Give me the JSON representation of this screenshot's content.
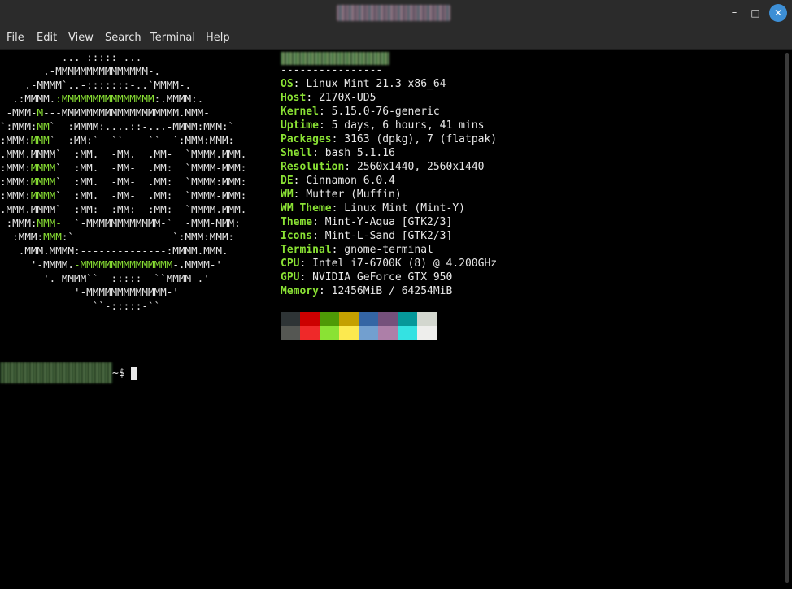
{
  "window": {
    "controls": {
      "minimize": "–",
      "maximize": "□",
      "close": "✕"
    }
  },
  "menu": [
    "File",
    "Edit",
    "View",
    "Search",
    "Terminal",
    "Help"
  ],
  "terminal": {
    "logo_lines": [
      [
        [
          "w",
          "          ...-:::::-..."
        ]
      ],
      [
        [
          "w",
          "       .-MMMMMMMMMMMMMMM-."
        ]
      ],
      [
        [
          "w",
          "    .-MMMM`..-:::::::-..`MMMM-."
        ]
      ],
      [
        [
          "w",
          "  .:MMMM."
        ],
        [
          "g",
          ":MMMMMMMMMMMMMMM"
        ],
        [
          "w",
          ":.MMMM:."
        ]
      ],
      [
        [
          "w",
          " -MMM-"
        ],
        [
          "g",
          "M"
        ],
        [
          "w",
          "---MMMMMMMMMMMMMMMMMMM.MMM-"
        ]
      ],
      [
        [
          "w",
          "`:MMM:"
        ],
        [
          "g",
          "MM"
        ],
        [
          "w",
          "`  :MMMM:....::-...-MMMM:MMM:`"
        ]
      ],
      [
        [
          "w",
          ":MMM:"
        ],
        [
          "g",
          "MMM"
        ],
        [
          "w",
          "`  :MM:`  ``    ``  `:MMM:MMM:"
        ]
      ],
      [
        [
          "w",
          ".MMM.MMMM`  :MM.  -MM.  .MM-  `MMMM.MMM."
        ]
      ],
      [
        [
          "w",
          ":MMM:"
        ],
        [
          "g",
          "MMMM"
        ],
        [
          "w",
          "`  :MM.  -MM-  .MM:  `MMMM-MMM:"
        ]
      ],
      [
        [
          "w",
          ":MMM:"
        ],
        [
          "g",
          "MMMM"
        ],
        [
          "w",
          "`  :MM.  -MM-  .MM:  `MMMM:MMM:"
        ]
      ],
      [
        [
          "w",
          ":MMM:"
        ],
        [
          "g",
          "MMMM"
        ],
        [
          "w",
          "`  :MM.  -MM-  .MM:  `MMMM-MMM:"
        ]
      ],
      [
        [
          "w",
          ".MMM.MMMM`  :MM:--:MM:--:MM:  `MMMM.MMM."
        ]
      ],
      [
        [
          "w",
          " :MMM:"
        ],
        [
          "g",
          "MMM-"
        ],
        [
          "w",
          "  `-MMMMMMMMMMMM-`  -MMM-MMM:"
        ]
      ],
      [
        [
          "w",
          "  :MMM:"
        ],
        [
          "g",
          "MMM"
        ],
        [
          "w",
          ":`                `:MMM:MMM:"
        ]
      ],
      [
        [
          "w",
          "   .MMM.MMMM:--------------:MMMM.MMM."
        ]
      ],
      [
        [
          "w",
          "     '-MMMM."
        ],
        [
          "g",
          "-MMMMMMMMMMMMMMM"
        ],
        [
          "w",
          "-.MMMM-'"
        ]
      ],
      [
        [
          "w",
          "       '.-MMMM``--:::::--``MMMM-.'"
        ]
      ],
      [
        [
          "w",
          "            '-MMMMMMMMMMMMM-'"
        ]
      ],
      [
        [
          "w",
          "               ``-:::::-``"
        ]
      ]
    ],
    "separator": "----------------",
    "info": [
      {
        "key": "OS",
        "value": "Linux Mint 21.3 x86_64"
      },
      {
        "key": "Host",
        "value": "Z170X-UD5"
      },
      {
        "key": "Kernel",
        "value": "5.15.0-76-generic"
      },
      {
        "key": "Uptime",
        "value": "5 days, 6 hours, 41 mins"
      },
      {
        "key": "Packages",
        "value": "3163 (dpkg), 7 (flatpak)"
      },
      {
        "key": "Shell",
        "value": "bash 5.1.16"
      },
      {
        "key": "Resolution",
        "value": "2560x1440, 2560x1440"
      },
      {
        "key": "DE",
        "value": "Cinnamon 6.0.4"
      },
      {
        "key": "WM",
        "value": "Mutter (Muffin)"
      },
      {
        "key": "WM Theme",
        "value": "Linux Mint (Mint-Y)"
      },
      {
        "key": "Theme",
        "value": "Mint-Y-Aqua [GTK2/3]"
      },
      {
        "key": "Icons",
        "value": "Mint-L-Sand [GTK2/3]"
      },
      {
        "key": "Terminal",
        "value": "gnome-terminal"
      },
      {
        "key": "CPU",
        "value": "Intel i7-6700K (8) @ 4.200GHz"
      },
      {
        "key": "GPU",
        "value": "NVIDIA GeForce GTX 950"
      },
      {
        "key": "Memory",
        "value": "12456MiB / 64254MiB"
      }
    ],
    "palette_top": [
      "#2e3436",
      "#cc0000",
      "#4e9a06",
      "#c4a000",
      "#3465a4",
      "#75507b",
      "#06989a",
      "#d3d7cf"
    ],
    "palette_bottom": [
      "#555753",
      "#ef2929",
      "#8ae234",
      "#fce94f",
      "#729fcf",
      "#ad7fa8",
      "#34e2e2",
      "#eeeeec"
    ],
    "prompt_suffix": "~$"
  }
}
